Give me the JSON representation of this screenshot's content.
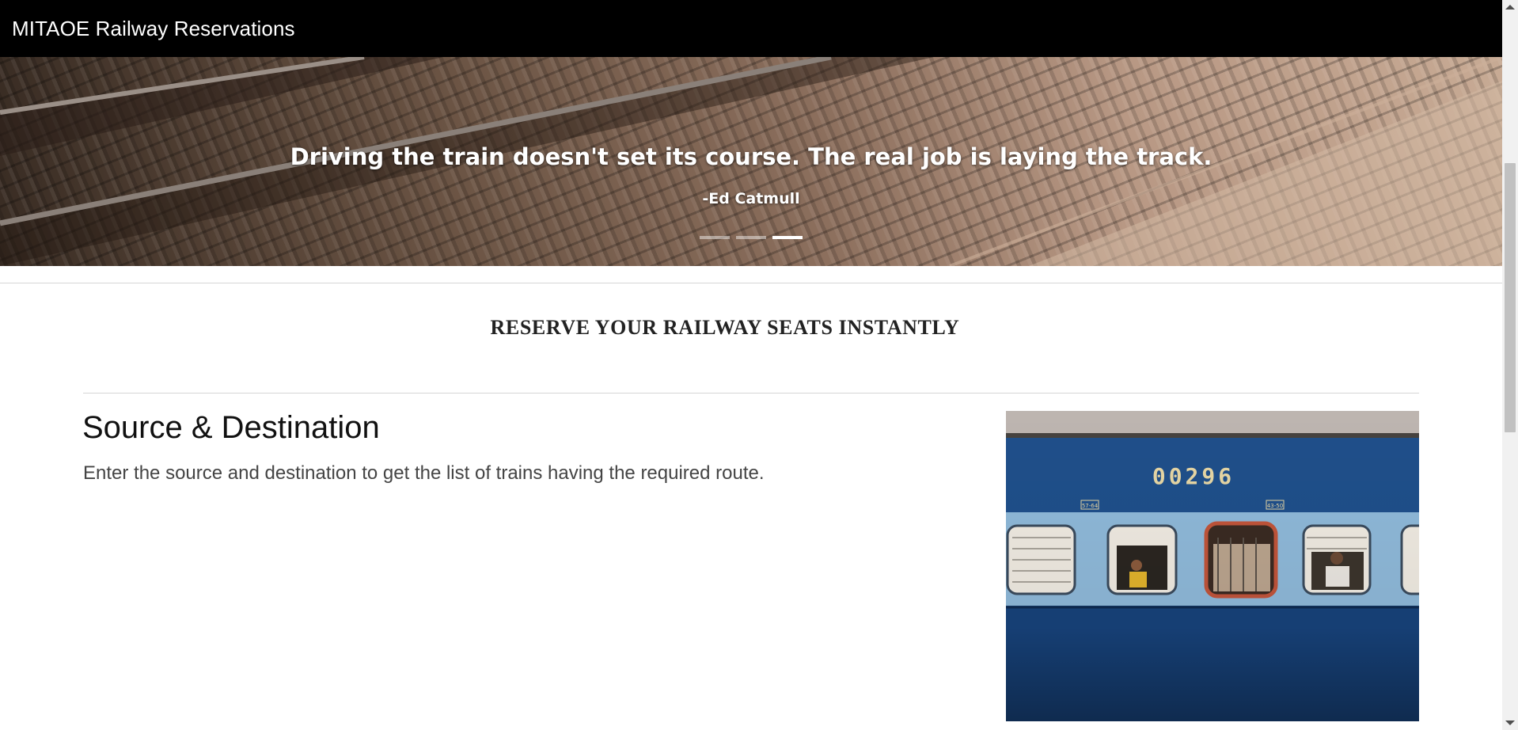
{
  "navbar": {
    "brand": "MITAOE Railway Reservations"
  },
  "carousel": {
    "quote": "Driving the train doesn't set its course. The real job is laying the track.",
    "author": "-Ed Catmull",
    "slide_count": 3,
    "active_slide": 3
  },
  "main": {
    "section_title": "RESERVE YOUR RAILWAY SEATS INSTANTLY",
    "feature": {
      "heading": "Source & Destination",
      "text": "Enter the source and destination to get the list of trains having the required route."
    },
    "image": {
      "coach_number": "00296",
      "left_tag": "57-64",
      "right_tag": "43-50"
    }
  }
}
